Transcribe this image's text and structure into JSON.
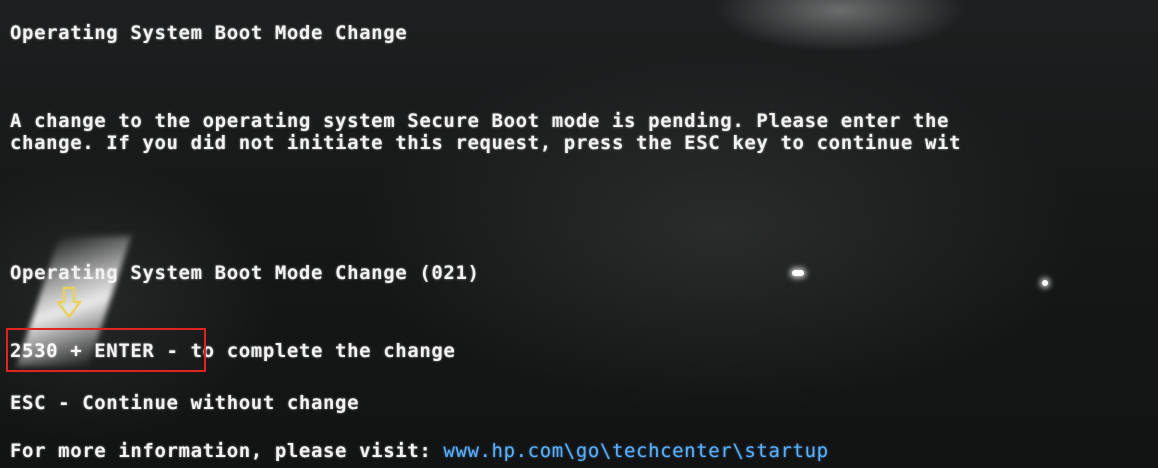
{
  "screen": {
    "title": "Operating System Boot Mode Change",
    "message_line1": "A change to the operating system Secure Boot mode is pending. Please enter the",
    "message_line2": "change. If you did not initiate this request, press the ESC key to continue wit",
    "prompt_title": "Operating System Boot Mode Change (021)",
    "option_confirm_key": "2530 + ENTER",
    "option_confirm_text": " - to complete the change",
    "option_esc": "ESC - Continue without change",
    "info_prefix": "For more information, please visit: ",
    "info_link": "www.hp.com\\go\\techcenter\\startup"
  },
  "annotations": {
    "box_color": "#e0241e",
    "arrow_color": "#e8d25a",
    "arrow_icon": "down-arrow-icon"
  },
  "colors": {
    "text": "#f2f2f2",
    "link": "#5ab0ff",
    "background": "#161818"
  }
}
